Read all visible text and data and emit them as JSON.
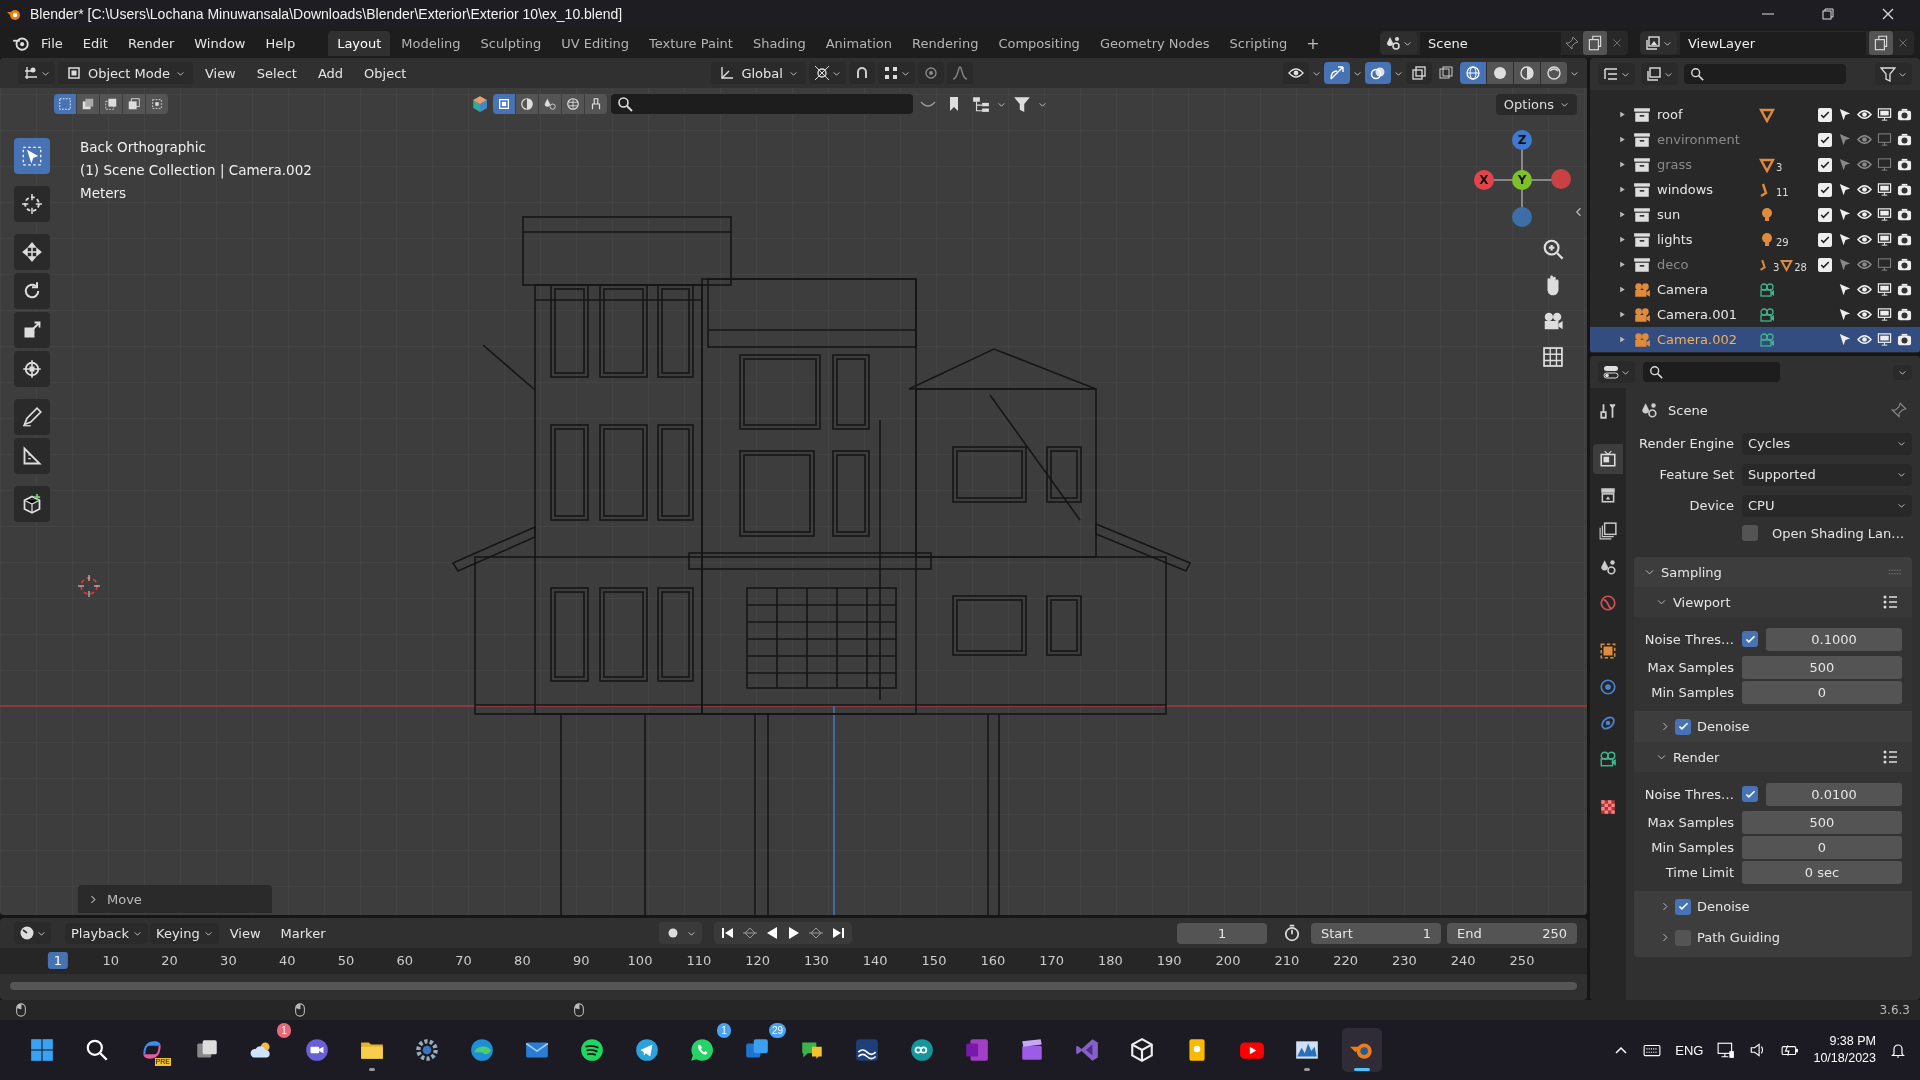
{
  "title_bar": {
    "title": "Blender* [C:\\Users\\Lochana Minuwansala\\Downloads\\Blender\\Exterior\\Exterior 10\\ex_10.blend]"
  },
  "menu": [
    "File",
    "Edit",
    "Render",
    "Window",
    "Help"
  ],
  "workspaces": [
    {
      "label": "Layout",
      "selected": true
    },
    {
      "label": "Modeling",
      "selected": false
    },
    {
      "label": "Sculpting",
      "selected": false
    },
    {
      "label": "UV Editing",
      "selected": false
    },
    {
      "label": "Texture Paint",
      "selected": false
    },
    {
      "label": "Shading",
      "selected": false
    },
    {
      "label": "Animation",
      "selected": false
    },
    {
      "label": "Rendering",
      "selected": false
    },
    {
      "label": "Compositing",
      "selected": false
    },
    {
      "label": "Geometry Nodes",
      "selected": false
    },
    {
      "label": "Scripting",
      "selected": false
    }
  ],
  "add_workspace": "+",
  "scene": {
    "value": "Scene"
  },
  "view_layer": {
    "value": "ViewLayer"
  },
  "viewport": {
    "mode": "Object Mode",
    "menus": [
      "View",
      "Select",
      "Add",
      "Object"
    ],
    "orientation": "Global",
    "toggles": [
      {
        "kind": "visibility",
        "on": false
      },
      {
        "kind": "gizmos",
        "on": true
      },
      {
        "kind": "overlays",
        "on": true
      },
      {
        "kind": "xray",
        "on": false
      }
    ],
    "shading": [
      {
        "kind": "wireframe",
        "selected": true
      },
      {
        "kind": "solid",
        "selected": false
      },
      {
        "kind": "material",
        "selected": false
      },
      {
        "kind": "rendered",
        "selected": false
      }
    ],
    "select_modes": [
      {
        "selected": true
      },
      {
        "selected": false
      },
      {
        "selected": false
      },
      {
        "selected": false
      },
      {
        "selected": false
      }
    ],
    "options": "Options",
    "info": [
      "Back Orthographic",
      "(1) Scene Collection | Camera.002",
      "Meters"
    ],
    "tools": [
      {
        "kind": "select",
        "selected": true
      },
      {
        "kind": "cursor",
        "selected": false
      },
      {
        "kind": "move",
        "selected": false
      },
      {
        "kind": "rotate",
        "selected": false
      },
      {
        "kind": "scale",
        "selected": false
      },
      {
        "kind": "transform",
        "selected": false
      },
      {
        "kind": "annotate",
        "selected": false
      },
      {
        "kind": "measure",
        "selected": false
      },
      {
        "kind": "add_cube",
        "selected": false
      }
    ],
    "gizmo": [
      {
        "kind": "z",
        "label": "Z"
      },
      {
        "kind": "x",
        "label": "X"
      },
      {
        "kind": "y",
        "label": "Y"
      }
    ],
    "last_operator": {
      "label": "Move",
      "expanded": false
    }
  },
  "outliner": {
    "rows": [
      {
        "name": "roof",
        "kind": "collection",
        "dimmed": false,
        "checked": true,
        "selected": false,
        "contents": [
          {
            "kind": "mesh"
          }
        ]
      },
      {
        "name": "environment",
        "kind": "collection",
        "dimmed": true,
        "checked": true,
        "selected": false,
        "contents": []
      },
      {
        "name": "grass",
        "kind": "collection",
        "dimmed": true,
        "checked": true,
        "selected": false,
        "contents": [
          {
            "kind": "mesh",
            "count": "3"
          }
        ]
      },
      {
        "name": "windows",
        "kind": "collection",
        "dimmed": false,
        "checked": true,
        "selected": false,
        "contents": [
          {
            "kind": "armature",
            "count": "11"
          }
        ]
      },
      {
        "name": "sun",
        "kind": "collection",
        "dimmed": false,
        "checked": true,
        "selected": false,
        "contents": [
          {
            "kind": "light"
          }
        ]
      },
      {
        "name": "lights",
        "kind": "collection",
        "dimmed": false,
        "checked": true,
        "selected": false,
        "contents": [
          {
            "kind": "light",
            "count": "29"
          }
        ]
      },
      {
        "name": "deco",
        "kind": "collection",
        "dimmed": true,
        "checked": true,
        "selected": false,
        "contents": [
          {
            "kind": "armature",
            "count": "3"
          },
          {
            "kind": "mesh",
            "count": "28"
          }
        ]
      },
      {
        "name": "Camera",
        "kind": "camera",
        "dimmed": false,
        "selected": false,
        "contents": [
          {
            "kind": "camera_data"
          }
        ]
      },
      {
        "name": "Camera.001",
        "kind": "camera",
        "dimmed": false,
        "selected": false,
        "contents": [
          {
            "kind": "camera_data"
          }
        ]
      },
      {
        "name": "Camera.002",
        "kind": "camera",
        "dimmed": false,
        "selected": true,
        "contents": [
          {
            "kind": "camera_data"
          }
        ]
      }
    ]
  },
  "properties": {
    "tabs": [
      {
        "kind": "tool",
        "selected": false
      },
      {
        "kind": "render",
        "selected": true
      },
      {
        "kind": "output",
        "selected": false
      },
      {
        "kind": "view_layer",
        "selected": false
      },
      {
        "kind": "scene",
        "selected": false
      },
      {
        "kind": "world",
        "selected": false
      },
      {
        "kind": "object",
        "selected": false
      },
      {
        "kind": "physics",
        "selected": false
      },
      {
        "kind": "constraints",
        "selected": false
      },
      {
        "kind": "data",
        "selected": false
      },
      {
        "kind": "texture",
        "selected": false
      }
    ],
    "context": "Scene",
    "fields": [
      {
        "label": "Render Engine",
        "value": "Cycles"
      },
      {
        "label": "Feature Set",
        "value": "Supported"
      },
      {
        "label": "Device",
        "value": "CPU"
      }
    ],
    "osl": {
      "label": "Open Shading Lan…",
      "checked": false
    },
    "panels": [
      {
        "title": "Sampling",
        "expanded": true,
        "subpanels": [
          {
            "title": "Viewport",
            "expanded": true,
            "rows": [
              {
                "kind": "toggle_number",
                "label": "Noise Thres…",
                "checked": true,
                "value": "0.1000"
              },
              {
                "kind": "number",
                "label": "Max Samples",
                "value": "500"
              },
              {
                "kind": "number",
                "label": "Min Samples",
                "value": "0"
              }
            ],
            "children": [
              {
                "title": "Denoise",
                "checked": true,
                "expanded": false
              }
            ]
          },
          {
            "title": "Render",
            "expanded": true,
            "rows": [
              {
                "kind": "toggle_number",
                "label": "Noise Thres…",
                "checked": true,
                "value": "0.0100"
              },
              {
                "kind": "number",
                "label": "Max Samples",
                "value": "500"
              },
              {
                "kind": "number",
                "label": "Min Samples",
                "value": "0"
              },
              {
                "kind": "number",
                "label": "Time Limit",
                "value": "0 sec"
              }
            ],
            "children": [
              {
                "title": "Denoise",
                "checked": true,
                "expanded": false
              },
              {
                "title": "Path Guiding",
                "checked": false,
                "expanded": false
              }
            ]
          }
        ]
      }
    ]
  },
  "timeline": {
    "menus": [
      {
        "label": "Playback",
        "kind": "dropdown"
      },
      {
        "label": "Keying",
        "kind": "dropdown"
      },
      {
        "label": "View",
        "kind": "menu"
      },
      {
        "label": "Marker",
        "kind": "menu"
      }
    ],
    "current": "1",
    "start_label": "Start",
    "start": "1",
    "end_label": "End",
    "end": "250",
    "ruler": [
      {
        "label": "1",
        "selected": true
      },
      {
        "label": "10",
        "selected": false
      },
      {
        "label": "20",
        "selected": false
      },
      {
        "label": "30",
        "selected": false
      },
      {
        "label": "40",
        "selected": false
      },
      {
        "label": "50",
        "selected": false
      },
      {
        "label": "60",
        "selected": false
      },
      {
        "label": "70",
        "selected": false
      },
      {
        "label": "80",
        "selected": false
      },
      {
        "label": "90",
        "selected": false
      },
      {
        "label": "100",
        "selected": false
      },
      {
        "label": "110",
        "selected": false
      },
      {
        "label": "120",
        "selected": false
      },
      {
        "label": "130",
        "selected": false
      },
      {
        "label": "140",
        "selected": false
      },
      {
        "label": "150",
        "selected": false
      },
      {
        "label": "160",
        "selected": false
      },
      {
        "label": "170",
        "selected": false
      },
      {
        "label": "180",
        "selected": false
      },
      {
        "label": "190",
        "selected": false
      },
      {
        "label": "200",
        "selected": false
      },
      {
        "label": "210",
        "selected": false
      },
      {
        "label": "220",
        "selected": false
      },
      {
        "label": "230",
        "selected": false
      },
      {
        "label": "240",
        "selected": false
      },
      {
        "label": "250",
        "selected": false
      }
    ]
  },
  "status_bar": {
    "version": "3.6.3"
  },
  "taskbar": {
    "apps": [
      {
        "kind": "start"
      },
      {
        "kind": "search"
      },
      {
        "kind": "copilot",
        "tag": "PRE"
      },
      {
        "kind": "taskview"
      },
      {
        "kind": "weather",
        "badge": "1"
      },
      {
        "kind": "meet"
      },
      {
        "kind": "folder",
        "running": true
      },
      {
        "kind": "gear"
      },
      {
        "kind": "browser"
      },
      {
        "kind": "mail"
      },
      {
        "kind": "music"
      },
      {
        "kind": "plane"
      },
      {
        "kind": "chat",
        "badge": "1"
      },
      {
        "kind": "tiles",
        "badge": "29"
      },
      {
        "kind": "chatapp"
      },
      {
        "kind": "map"
      },
      {
        "kind": "infinity"
      },
      {
        "kind": "notebook"
      },
      {
        "kind": "clapper"
      },
      {
        "kind": "ribbon"
      },
      {
        "kind": "cube"
      },
      {
        "kind": "note"
      },
      {
        "kind": "video"
      },
      {
        "kind": "chart",
        "running": true
      },
      {
        "kind": "blender",
        "running": true,
        "active": true
      }
    ],
    "language": "ENG",
    "time": "9:38 PM",
    "date": "10/18/2023"
  }
}
